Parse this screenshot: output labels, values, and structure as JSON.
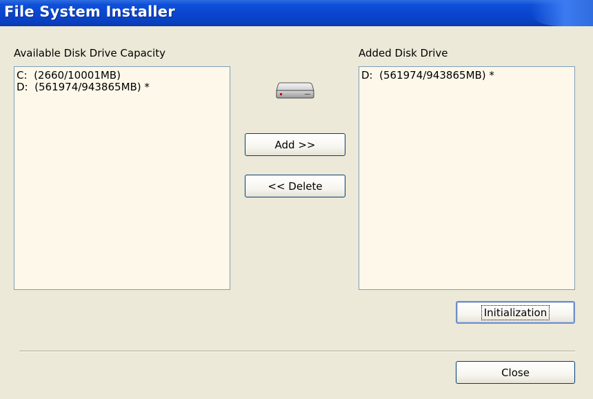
{
  "window": {
    "title": "File System Installer"
  },
  "available": {
    "label": "Available Disk Drive Capacity",
    "items": [
      "C:  (2660/10001MB)",
      "D:  (561974/943865MB) *"
    ]
  },
  "added": {
    "label": "Added Disk Drive",
    "items": [
      "D:  (561974/943865MB) *"
    ]
  },
  "buttons": {
    "add": "Add >>",
    "delete": "<< Delete",
    "initialization": "Initialization",
    "close": "Close"
  },
  "icons": {
    "drive": "hard-drive-icon"
  },
  "colors": {
    "titlebar": "#0a45cf",
    "window_bg": "#ece9d8",
    "listbox_bg": "#fdf8ea"
  }
}
